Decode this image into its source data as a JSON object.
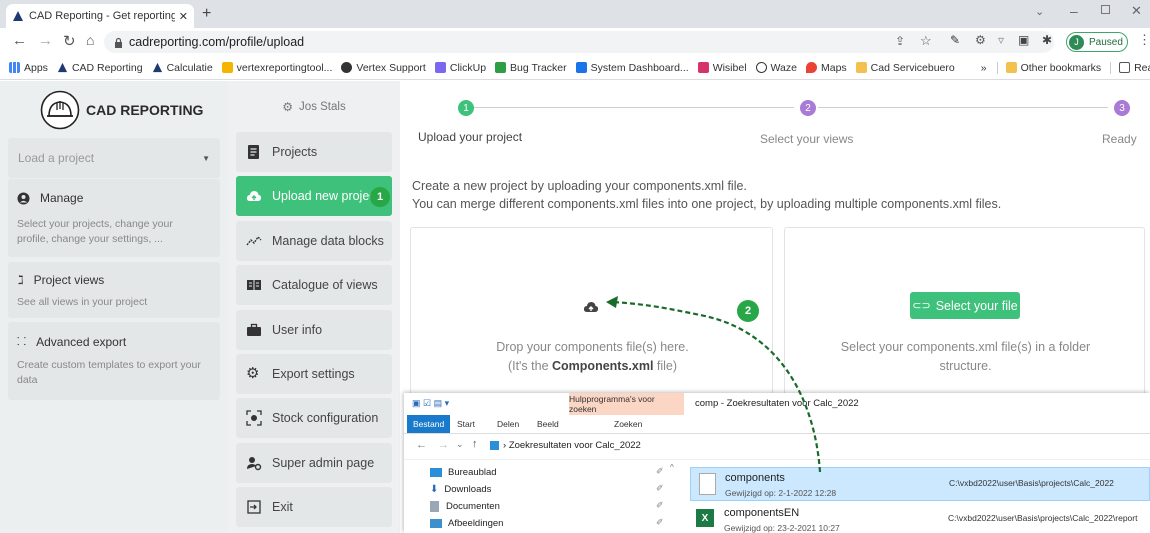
{
  "browser": {
    "tab_title": "CAD Reporting - Get reporting o...",
    "url": "cadreporting.com/profile/upload",
    "profile_status": "Paused",
    "profile_initial": "J",
    "bookmarks": [
      "Apps",
      "CAD Reporting",
      "Calculatie",
      "vertexreportingtool...",
      "Vertex Support",
      "ClickUp",
      "Bug Tracker",
      "System Dashboard...",
      "Wisibel",
      "Waze",
      "Maps",
      "Cad Servicebuero"
    ],
    "other_bookmarks": "Other bookmarks",
    "reading_list": "Reading list",
    "more": "»"
  },
  "sidebar": {
    "logo_text": "CAD REPORTING",
    "load_project_placeholder": "Load a project",
    "sections": [
      {
        "title": "Manage",
        "desc": "Select your projects, change your profile, change your settings, ..."
      },
      {
        "title": "Project views",
        "desc": "See all views in your project"
      },
      {
        "title": "Advanced export",
        "desc": "Create custom templates to export your data"
      }
    ]
  },
  "menu": {
    "user": "Jos Stals",
    "items": [
      "Projects",
      "Upload new project",
      "Manage data blocks",
      "Catalogue of views",
      "User info",
      "Export settings",
      "Stock configuration",
      "Super admin page",
      "Exit"
    ],
    "badge": "1"
  },
  "steps": {
    "labels": [
      "Upload your project",
      "Select your views",
      "Ready"
    ],
    "numbers": [
      "1",
      "2",
      "3"
    ]
  },
  "main": {
    "intro1": "Create a new project by uploading your components.xml file.",
    "intro2": "You can merge different components.xml files into one project, by uploading multiple components.xml files.",
    "drop_line1": "Drop your components file(s) here.",
    "drop_line2_pre": "(It's the ",
    "drop_line2_bold": "Components.xml",
    "drop_line2_post": " file)",
    "select_button": "Select your file",
    "select_desc1": "Select your components.xml file(s) in a folder",
    "select_desc2": "structure.",
    "badge2": "2"
  },
  "explorer": {
    "ribbon_tool": "Hulpprogramma's voor zoeken",
    "window_title": "comp - Zoekresultaten voor Calc_2022",
    "tabs": [
      "Bestand",
      "Start",
      "Delen",
      "Beeld"
    ],
    "search_tab": "Zoeken",
    "breadcrumb": "Zoekresultaten voor Calc_2022",
    "nav_items": [
      "Bureaublad",
      "Downloads",
      "Documenten",
      "Afbeeldingen"
    ],
    "files": [
      {
        "name": "components",
        "modified": "Gewijzigd op: 2-1-2022 12:28",
        "path": "C:\\vxbd2022\\user\\Basis\\projects\\Calc_2022"
      },
      {
        "name": "componentsEN",
        "modified": "Gewijzigd op: 23-2-2021 10:27",
        "path": "C:\\vxbd2022\\user\\Basis\\projects\\Calc_2022\\report"
      }
    ]
  },
  "colors": {
    "accent_green": "#3ec17a",
    "step_purple": "#a97ad6",
    "badge_green": "#27a745"
  }
}
